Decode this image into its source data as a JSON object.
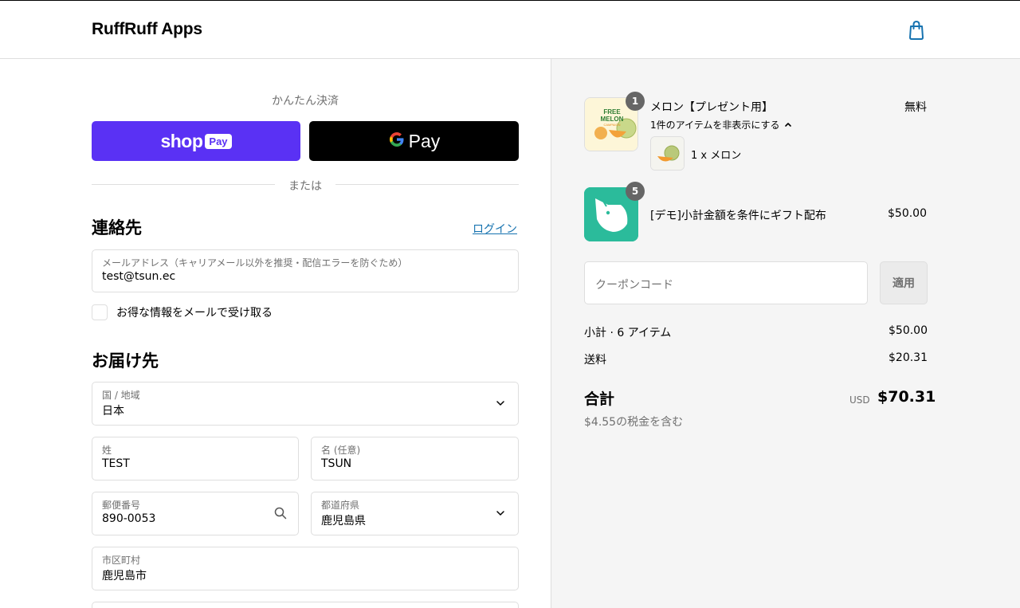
{
  "header": {
    "brand": "RuffRuff Apps",
    "cart_icon": "shopping-bag-icon"
  },
  "express": {
    "title": "かんたん決済",
    "shop_pay_word": "shop",
    "shop_pay_badge": "Pay",
    "gpay_label": "Pay",
    "divider": "または"
  },
  "contact": {
    "title": "連絡先",
    "login_link": "ログイン",
    "email_label": "メールアドレス（キャリアメール以外を推奨・配信エラーを防ぐため）",
    "email_value": "test@tsun.ec",
    "newsletter_label": "お得な情報をメールで受け取る"
  },
  "delivery": {
    "title": "お届け先",
    "country_label": "国 / 地域",
    "country_value": "日本",
    "last_name_label": "姓",
    "last_name_value": "TEST",
    "first_name_label": "名 (任意)",
    "first_name_value": "TSUN",
    "postal_label": "郵便番号",
    "postal_value": "890-0053",
    "prefecture_label": "都道府県",
    "prefecture_value": "鹿児島県",
    "city_label": "市区町村",
    "city_value": "鹿児島市"
  },
  "summary": {
    "items": [
      {
        "name": "メロン【プレゼント用】",
        "quantity": "1",
        "price": "無料",
        "toggle": "1件のアイテムを非表示にする",
        "sub_item": "1 x メロン",
        "thumb_text": [
          "FREE",
          "MELON",
          "CAMPAIGN"
        ]
      },
      {
        "name": "[デモ]小計金額を条件にギフト配布",
        "quantity": "5",
        "price": "$50.00"
      }
    ],
    "coupon_placeholder": "クーポンコード",
    "apply_label": "適用",
    "subtotal_label": "小計 · 6 アイテム",
    "subtotal_value": "$50.00",
    "shipping_label": "送料",
    "shipping_value": "$20.31",
    "total_label": "合計",
    "total_currency": "USD",
    "total_value": "$70.31",
    "tax_note": "$4.55の税金を含む"
  },
  "colors": {
    "shop_pay": "#5a31f4",
    "link": "#1773b0",
    "summary_bg": "#f5f5f5",
    "brand_green": "#2bbb9b"
  }
}
